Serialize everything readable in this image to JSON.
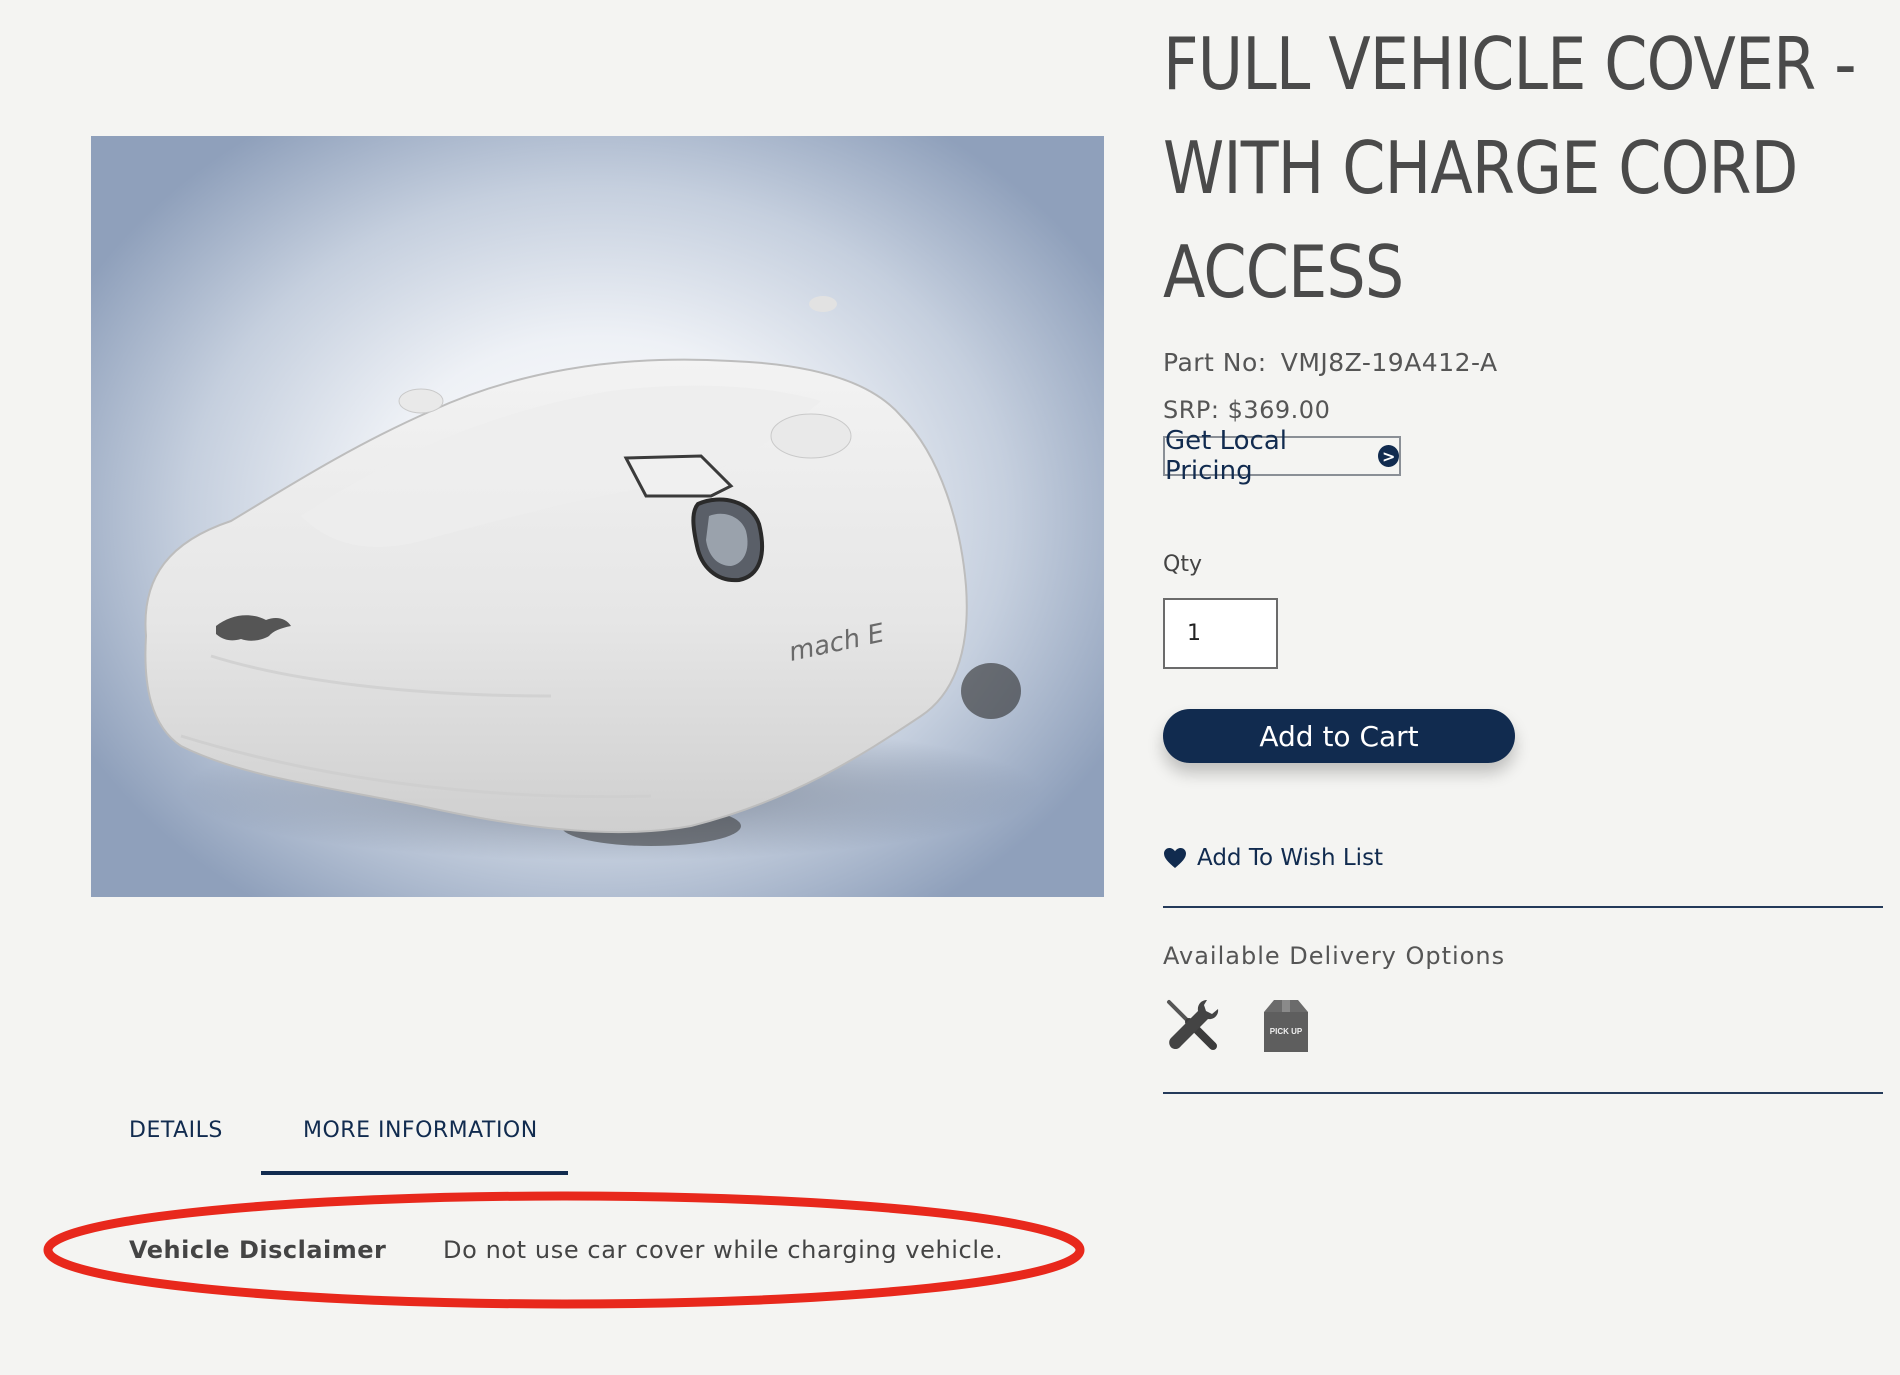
{
  "product": {
    "title": "FULL VEHICLE COVER - WITH CHARGE CORD ACCESS",
    "part_no_label": "Part No:",
    "part_no": "VMJ8Z-19A412-A",
    "srp": "SRP: $369.00",
    "image_logo_text": "mach E"
  },
  "pricing": {
    "local_pricing_label": "Get Local Pricing"
  },
  "purchase": {
    "qty_label": "Qty",
    "qty_value": "1",
    "add_to_cart_label": "Add to Cart",
    "wishlist_label": "Add To Wish List"
  },
  "delivery": {
    "heading": "Available Delivery Options",
    "options": [
      {
        "icon": "wrench-screwdriver-icon"
      },
      {
        "icon": "pickup-box-icon",
        "label": "PICK UP"
      }
    ]
  },
  "tabs": [
    {
      "label": "DETAILS",
      "active": false
    },
    {
      "label": "MORE INFORMATION",
      "active": true
    }
  ],
  "more_information": {
    "disclaimer_label": "Vehicle Disclaimer",
    "disclaimer_text": "Do not use car cover while charging vehicle."
  },
  "colors": {
    "brand_navy": "#112b4f",
    "background": "#f4f4f2",
    "highlight_red": "#e8281c"
  }
}
